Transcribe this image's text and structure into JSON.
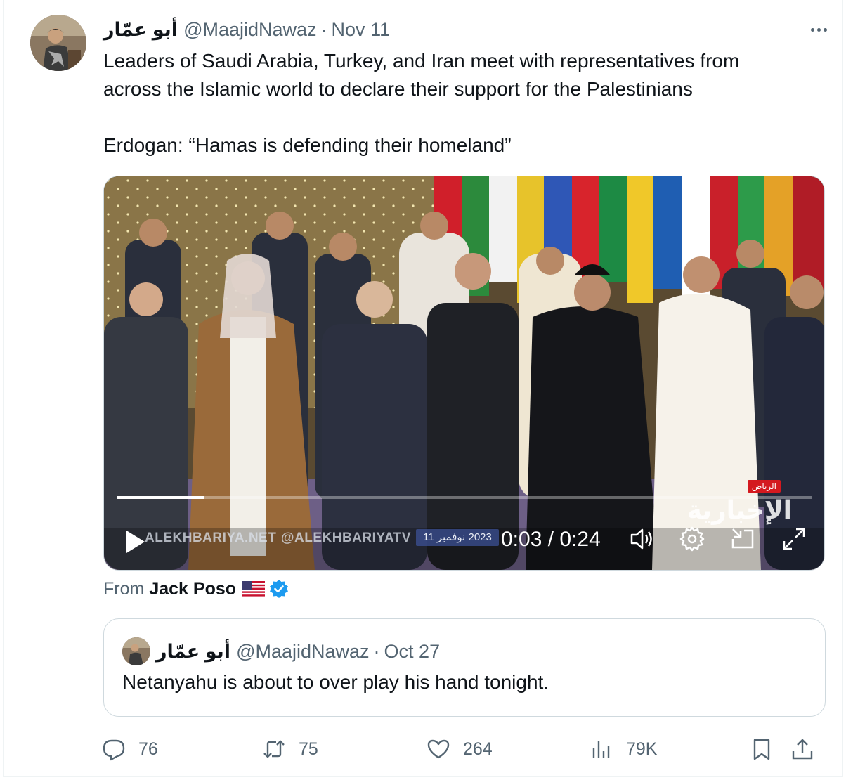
{
  "tweet": {
    "display_name": "أبو عمّار",
    "handle": "@MaajidNawaz",
    "separator": "·",
    "date": "Nov 11",
    "avatar_icon": "user-avatar-photo",
    "more_icon": "more-horizontal-icon",
    "text_lines": [
      "Leaders of Saudi Arabia, Turkey, and Iran meet with representatives from",
      "across the Islamic world to declare their support for the Palestinians"
    ],
    "text_quote": "Erdogan: “Hamas is defending their homeland”"
  },
  "video": {
    "watermark_site": "ALEKHBARIYA.NET",
    "watermark_handle": "@ALEKHBARIYATV",
    "date_overlay": "2023 نوفمبر 11",
    "channel_logo": "الإخبارية",
    "channel_tag": "الرياض",
    "time_display": "0:03 / 0:24",
    "progress": 0.125,
    "icons": [
      "play-icon",
      "volume-icon",
      "settings-gear-icon",
      "picture-in-picture-icon",
      "fullscreen-icon"
    ]
  },
  "source": {
    "prefix": "From",
    "name": "Jack Poso",
    "flag_icon": "us-flag-icon",
    "verified_icon": "verified-badge-icon",
    "verified_color": "#1d9bf0"
  },
  "quoted": {
    "display_name": "أبو عمّار",
    "handle": "@MaajidNawaz",
    "separator": "·",
    "date": "Oct 27",
    "text": "Netanyahu is about to over play his hand tonight."
  },
  "actions": {
    "replies": "76",
    "retweets": "75",
    "likes": "264",
    "views": "79K",
    "icons": [
      "reply-icon",
      "retweet-icon",
      "like-icon",
      "views-icon",
      "bookmark-icon",
      "share-icon"
    ]
  },
  "colors": {
    "text_primary": "#0f1419",
    "text_secondary": "#536471",
    "border": "#cfd9de"
  }
}
